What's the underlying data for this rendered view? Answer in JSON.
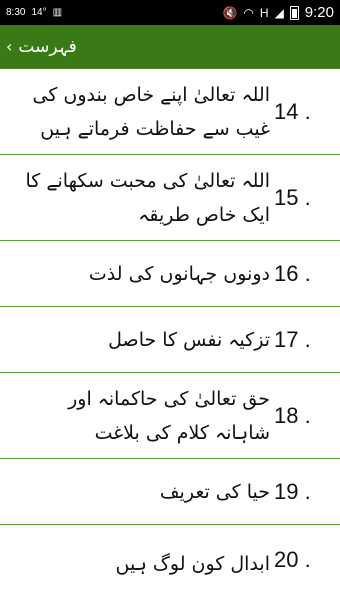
{
  "statusbar": {
    "left1": "8:30",
    "left2": "14°",
    "time": "9:20",
    "signal": "H"
  },
  "appbar": {
    "title": "فہرست"
  },
  "items": [
    {
      "num": "14 .",
      "text": "اللہ تعالیٰ اپنے خاص بندوں کی غیب سے حفاظت فرماتے ہیں"
    },
    {
      "num": "15 .",
      "text": "اللہ  تعالیٰ کی محبت سکھانے کا ایک خاص طریقہ"
    },
    {
      "num": "16 .",
      "text": "دونوں جہانوں کی لذت"
    },
    {
      "num": "17 .",
      "text": "تزکیہ نفس کا حاصل"
    },
    {
      "num": "18 .",
      "text": "حق تعالیٰ کی حاکمانہ اور شاہانہ کلام کی بلاغت"
    },
    {
      "num": "19 .",
      "text": "حیا کی تعریف"
    },
    {
      "num": "20 .",
      "text": "ابدال کون لوگ ہیں"
    }
  ]
}
